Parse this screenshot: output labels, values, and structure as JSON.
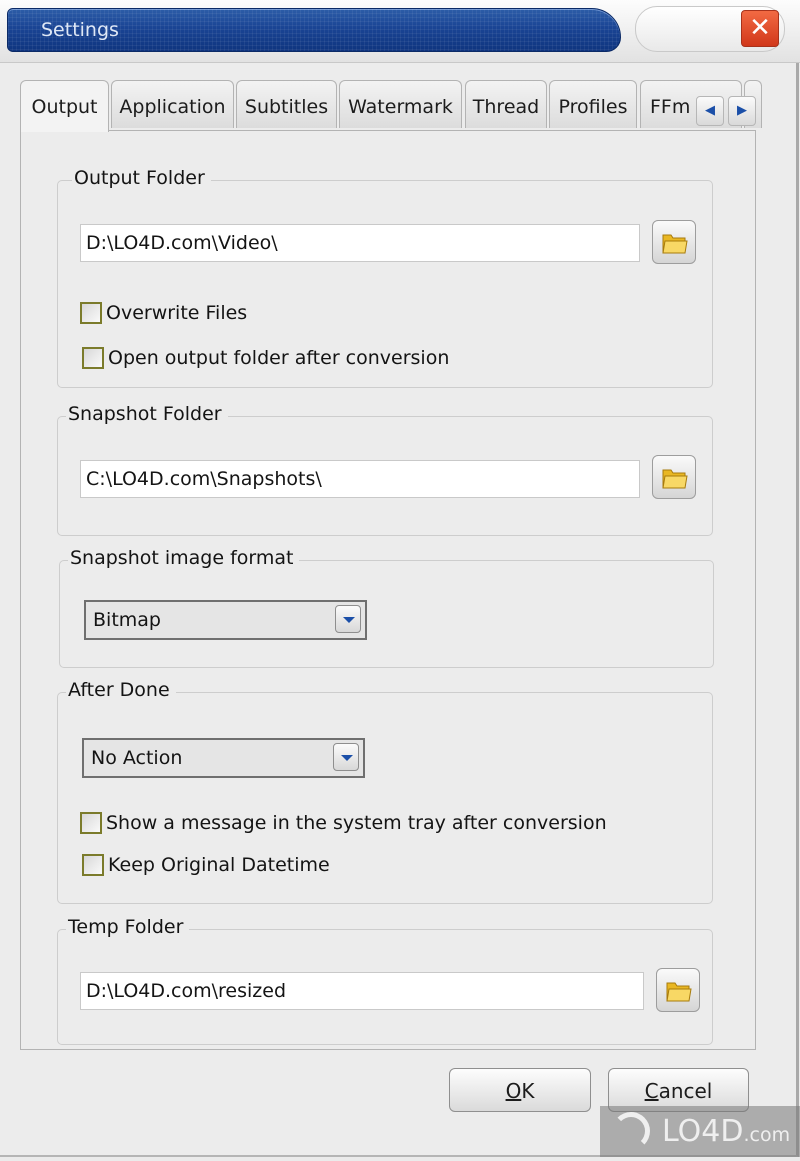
{
  "window": {
    "title": "Settings",
    "close_label": "✕"
  },
  "tabs": [
    {
      "label": "Output",
      "active": true
    },
    {
      "label": "Application",
      "active": false
    },
    {
      "label": "Subtitles",
      "active": false
    },
    {
      "label": "Watermark",
      "active": false
    },
    {
      "label": "Thread",
      "active": false
    },
    {
      "label": "Profiles",
      "active": false
    },
    {
      "label": "FFm",
      "active": false
    }
  ],
  "tab_scroll": {
    "left_label": "◀",
    "right_label": "▶"
  },
  "output_folder": {
    "legend": "Output Folder",
    "path": "D:\\LO4D.com\\Video\\",
    "overwrite_files": {
      "label": "Overwrite Files",
      "checked": false
    },
    "open_after": {
      "label": "Open output folder after conversion",
      "checked": false
    }
  },
  "snapshot_folder": {
    "legend": "Snapshot Folder",
    "path": "C:\\LO4D.com\\Snapshots\\"
  },
  "snapshot_format": {
    "legend": "Snapshot image format",
    "selected": "Bitmap"
  },
  "after_done": {
    "legend": "After Done",
    "selected": "No Action",
    "show_message": {
      "label": "Show a message in the system tray after conversion",
      "checked": false
    },
    "keep_datetime": {
      "label": "Keep Original Datetime",
      "checked": false
    }
  },
  "temp_folder": {
    "legend": "Temp Folder",
    "path": "D:\\LO4D.com\\resized"
  },
  "buttons": {
    "ok_mnemonic": "O",
    "ok_rest": "K",
    "cancel_mnemonic": "C",
    "cancel_rest": "ancel"
  },
  "watermark": {
    "brand": "LO4D",
    "suffix": ".com"
  }
}
